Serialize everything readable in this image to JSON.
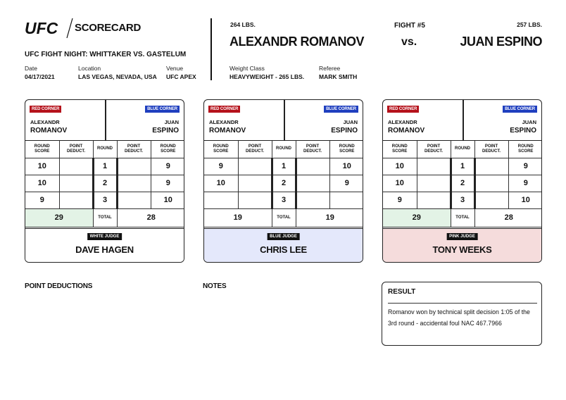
{
  "header": {
    "logo_text": "UFC",
    "title": "SCORECARD",
    "event": "UFC FIGHT NIGHT: WHITTAKER VS. GASTELUM",
    "date_label": "Date",
    "date": "04/17/2021",
    "location_label": "Location",
    "location": "LAS VEGAS, NEVADA, USA",
    "venue_label": "Venue",
    "venue": "UFC APEX",
    "weight_class_label": "Weight Class",
    "weight_class": "HEAVYWEIGHT - 265 LBS.",
    "referee_label": "Referee",
    "referee": "MARK SMITH",
    "fight_number": "FIGHT #5",
    "vs": "vs.",
    "red_weight": "264 LBS.",
    "red_fighter": "ALEXANDR ROMANOV",
    "blue_weight": "257 LBS.",
    "blue_fighter": "JUAN ESPINO"
  },
  "labels": {
    "red_corner": "RED CORNER",
    "blue_corner": "BLUE CORNER",
    "red_first": "ALEXANDR",
    "red_last": "ROMANOV",
    "blue_first": "JUAN",
    "blue_last": "ESPINO",
    "round_score_1": "ROUND",
    "round_score_2": "SCORE",
    "point_deduct_1": "POINT",
    "point_deduct_2": "DEDUCT.",
    "round": "ROUND",
    "total": "TOTAL"
  },
  "judges": [
    {
      "badge": "WHITE JUDGE",
      "name": "DAVE HAGEN",
      "rounds": [
        {
          "red": "10",
          "red_ded": "",
          "round": "1",
          "blue_ded": "",
          "blue": "9"
        },
        {
          "red": "10",
          "red_ded": "",
          "round": "2",
          "blue_ded": "",
          "blue": "9"
        },
        {
          "red": "9",
          "red_ded": "",
          "round": "3",
          "blue_ded": "",
          "blue": "10"
        }
      ],
      "red_total": "29",
      "blue_total": "28"
    },
    {
      "badge": "BLUE JUDGE",
      "name": "CHRIS LEE",
      "rounds": [
        {
          "red": "9",
          "red_ded": "",
          "round": "1",
          "blue_ded": "",
          "blue": "10"
        },
        {
          "red": "10",
          "red_ded": "",
          "round": "2",
          "blue_ded": "",
          "blue": "9"
        },
        {
          "red": "",
          "red_ded": "",
          "round": "3",
          "blue_ded": "",
          "blue": ""
        }
      ],
      "red_total": "19",
      "blue_total": "19"
    },
    {
      "badge": "PINK JUDGE",
      "name": "TONY WEEKS",
      "rounds": [
        {
          "red": "10",
          "red_ded": "",
          "round": "1",
          "blue_ded": "",
          "blue": "9"
        },
        {
          "red": "10",
          "red_ded": "",
          "round": "2",
          "blue_ded": "",
          "blue": "9"
        },
        {
          "red": "9",
          "red_ded": "",
          "round": "3",
          "blue_ded": "",
          "blue": "10"
        }
      ],
      "red_total": "29",
      "blue_total": "28"
    }
  ],
  "sections": {
    "point_deductions": "POINT DEDUCTIONS",
    "notes": "NOTES",
    "result_title": "RESULT",
    "result_text": "Romanov won by technical split decision 1:05 of the 3rd round - accidental foul NAC 467.7966"
  },
  "colors": {
    "red_corner": "#b5121b",
    "blue_corner": "#1f3fbf",
    "winner_highlight": "#e3f3e6",
    "blue_judge_bg": "#e4e8fb",
    "pink_judge_bg": "#f5dcdc"
  }
}
